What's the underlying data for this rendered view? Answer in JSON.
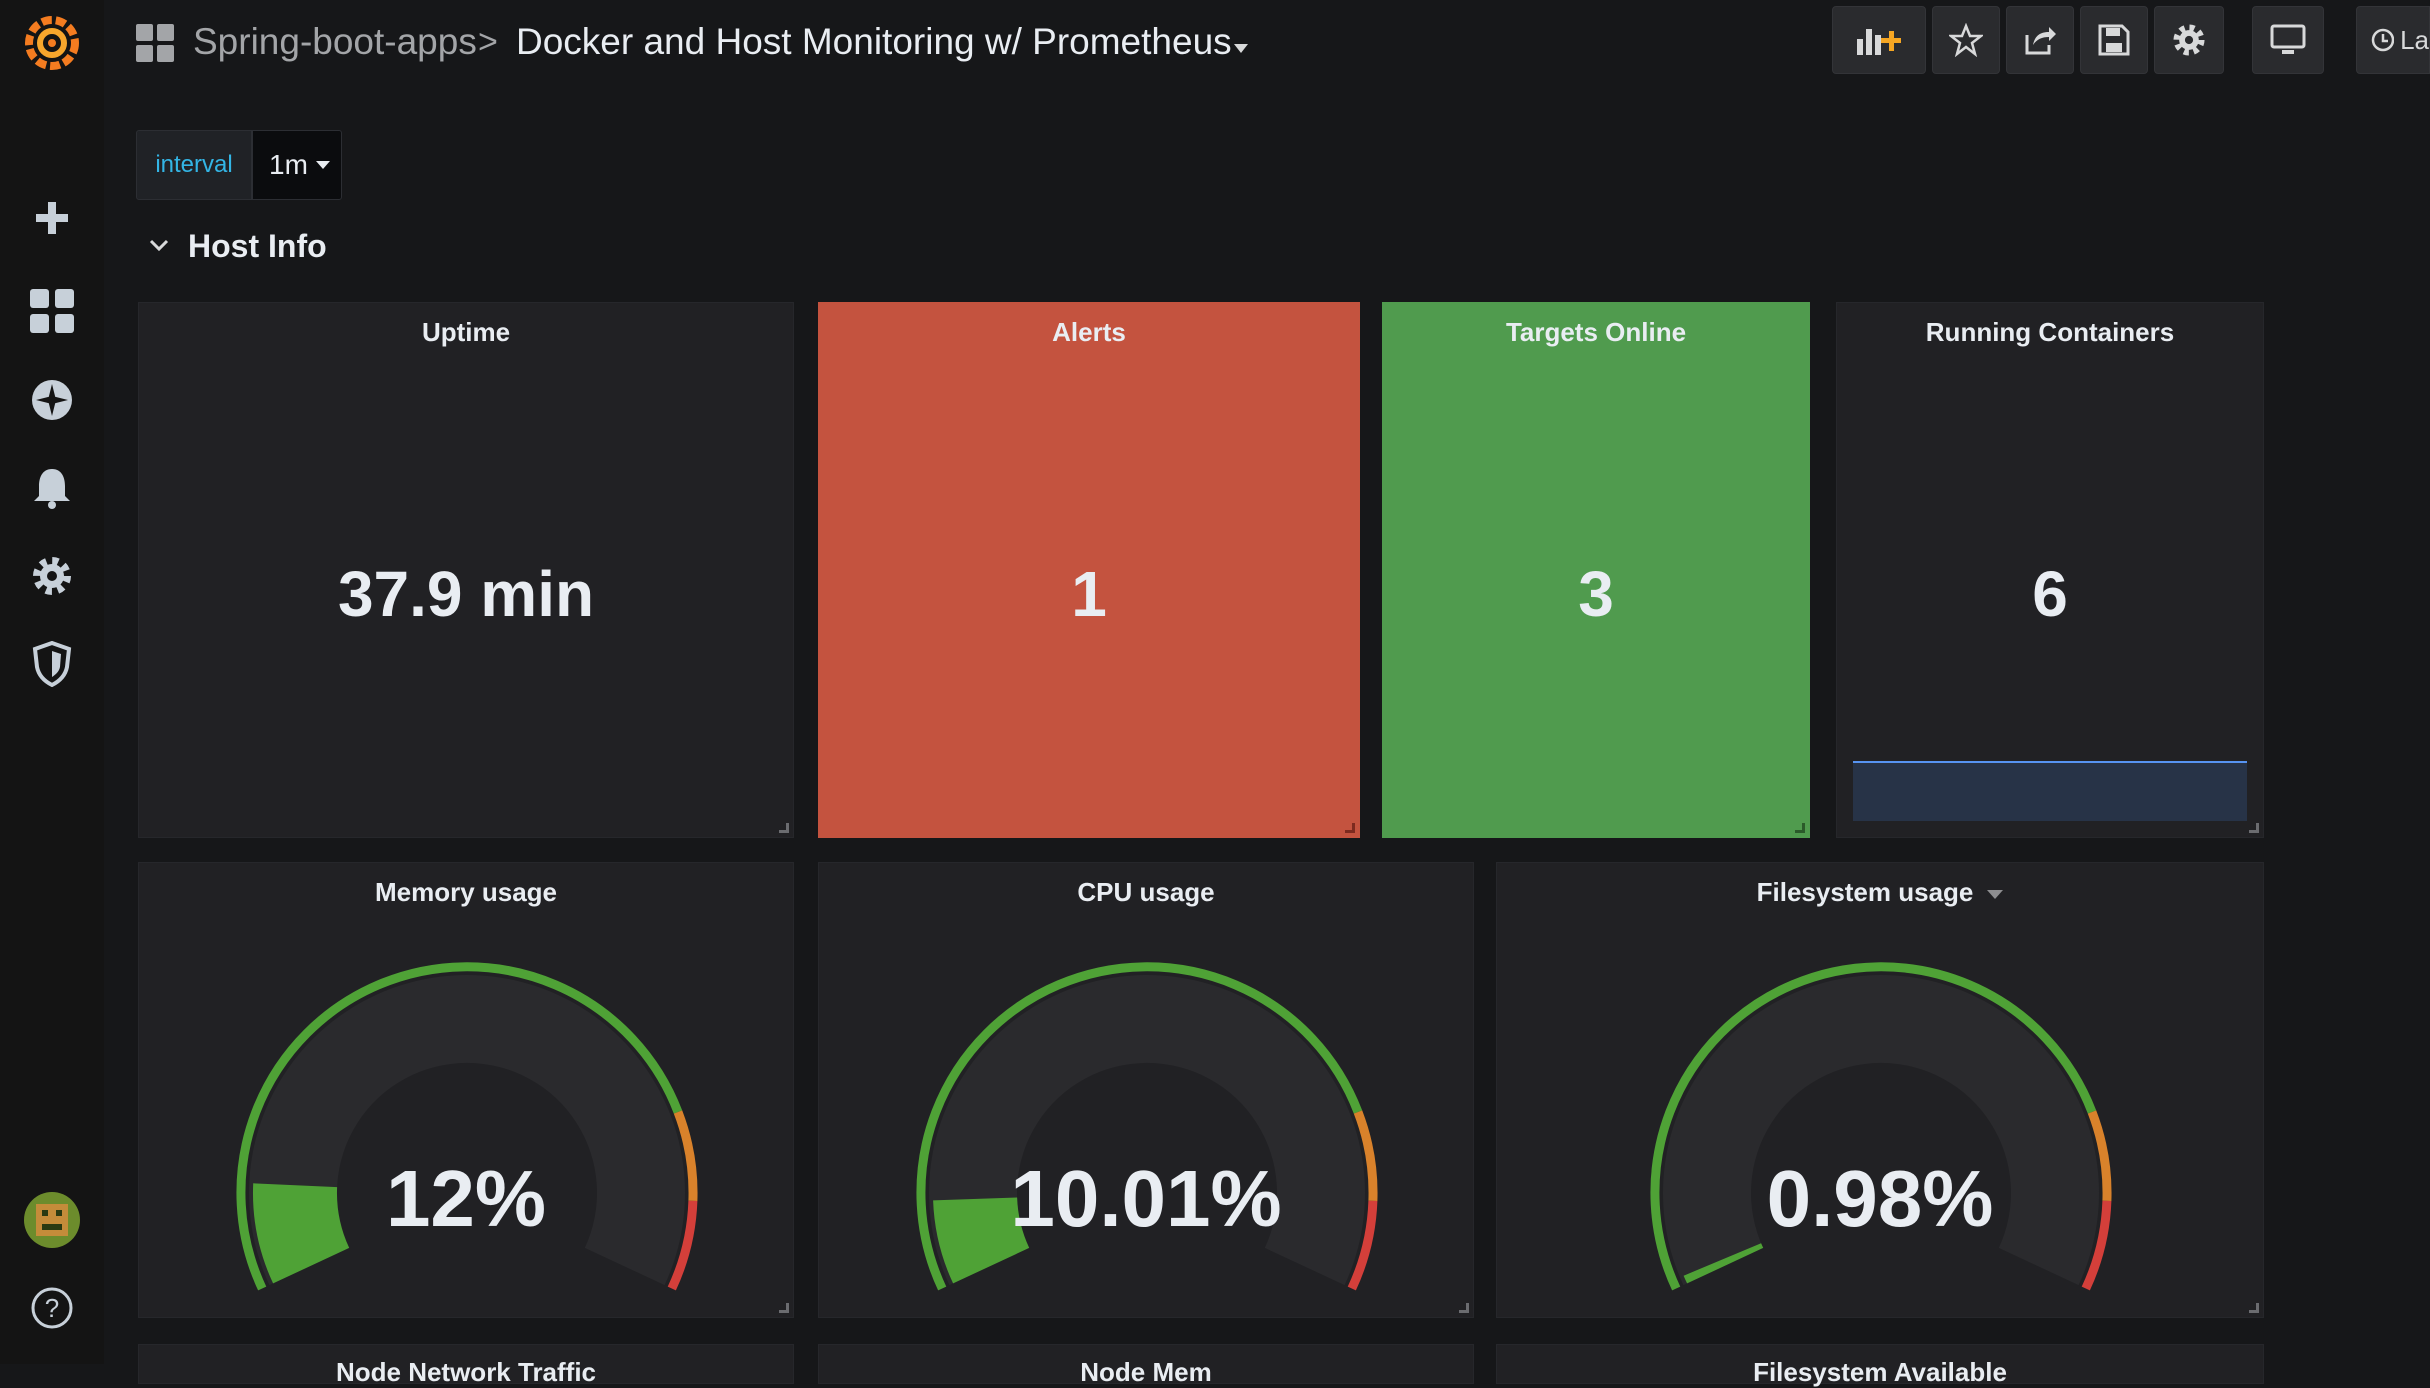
{
  "breadcrumb": {
    "folder": "Spring-boot-apps",
    "separator": ">",
    "dashboard_title": "Docker and Host Monitoring w/ Prometheus"
  },
  "toolbar": {
    "time_picker_label": "La"
  },
  "variables": {
    "interval": {
      "label": "interval",
      "value": "1m"
    }
  },
  "row": {
    "title": "Host Info"
  },
  "stats": {
    "uptime": {
      "title": "Uptime",
      "value": "37.9 min"
    },
    "alerts": {
      "title": "Alerts",
      "value": "1",
      "color": "#c4533f"
    },
    "targets": {
      "title": "Targets Online",
      "value": "3",
      "color": "#509b4e"
    },
    "containers": {
      "title": "Running Containers",
      "value": "6"
    }
  },
  "gauges": {
    "memory": {
      "title": "Memory usage",
      "value": "12%",
      "percent": 12
    },
    "cpu": {
      "title": "CPU usage",
      "value": "10.01%",
      "percent": 10.01
    },
    "filesystem": {
      "title": "Filesystem usage",
      "value": "0.98%",
      "percent": 0.98
    }
  },
  "bottom_panels": {
    "p1": "Node Network Traffic",
    "p2": "Node Mem",
    "p3": "Filesystem Available"
  },
  "colors": {
    "green": "#4fa236",
    "orange": "#d9822b",
    "red": "#d43f3a",
    "accent_blue": "#33b5e5"
  }
}
